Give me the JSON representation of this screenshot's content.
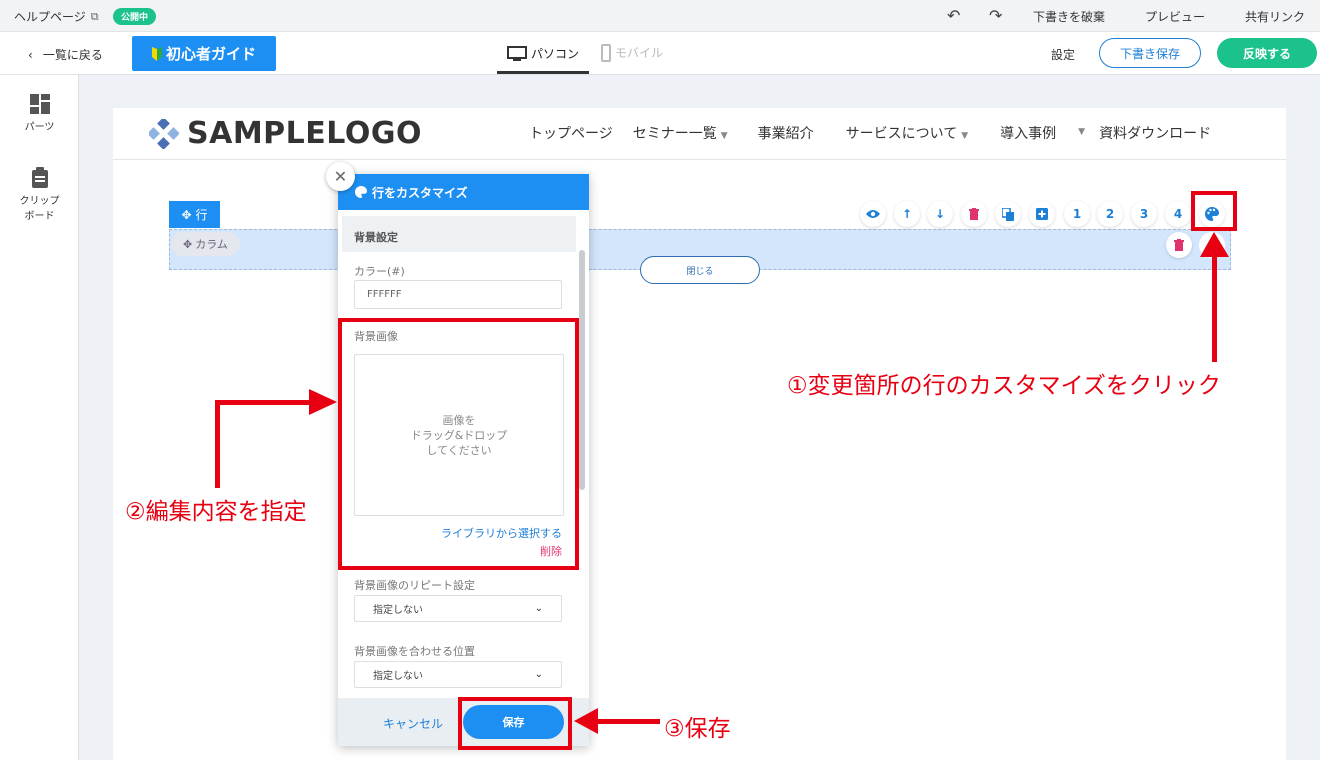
{
  "topbar": {
    "help_label": "ヘルプページ",
    "status_badge": "公開中",
    "discard_draft": "下書きを破棄",
    "preview": "プレビュー",
    "share_link": "共有リンク"
  },
  "toolbar": {
    "back": "一覧に戻る",
    "guide": "初心者ガイド",
    "pc_tab": "パソコン",
    "mobile_tab": "モバイル",
    "settings": "設定",
    "save_draft": "下書き保存",
    "publish": "反映する"
  },
  "sidebar": {
    "items": [
      {
        "label": "パーツ",
        "icon": "grid-icon"
      },
      {
        "label_line1": "クリップ",
        "label_line2": "ボード",
        "icon": "clipboard-icon"
      }
    ]
  },
  "site": {
    "logo": "SAMPLELOGO",
    "nav": [
      "トップページ",
      "セミナー一覧",
      "事業紹介",
      "サービスについて",
      "導入事例",
      "資料ダウンロード"
    ]
  },
  "editor": {
    "row_tag": "行",
    "column_tag": "カラム",
    "close_button": "閉じる",
    "layout_numbers": [
      "1",
      "2",
      "3",
      "4"
    ]
  },
  "modal": {
    "title": "行をカスタマイズ",
    "section": "背景設定",
    "color_label": "カラー(#)",
    "color_value": "FFFFFF",
    "bg_image_label": "背景画像",
    "drop_line1": "画像を",
    "drop_line2": "ドラッグ&ドロップ",
    "drop_line3": "してください",
    "library_link": "ライブラリから選択する",
    "delete_link": "削除",
    "repeat_label": "背景画像のリピート設定",
    "repeat_value": "指定しない",
    "position_label": "背景画像を合わせる位置",
    "position_value": "指定しない",
    "cancel": "キャンセル",
    "save": "保存"
  },
  "annotations": {
    "step1": "①変更箇所の行のカスタマイズをクリック",
    "step2": "②編集内容を指定",
    "step3": "③保存",
    "color": "#e60012"
  },
  "colors": {
    "accent": "#1d8ff2",
    "publish": "#1cc28c",
    "danger": "#e0326e"
  }
}
